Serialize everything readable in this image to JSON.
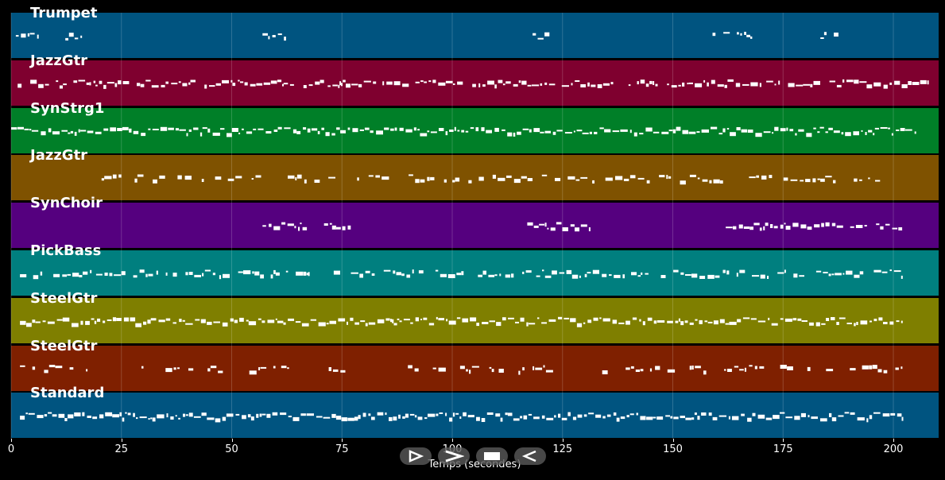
{
  "tracks": [
    {
      "name": "Trumpet",
      "color": "#005480",
      "segments": [
        [
          0,
          6
        ],
        [
          11,
          16
        ],
        [
          57,
          63
        ],
        [
          117,
          123
        ],
        [
          158,
          168
        ],
        [
          182,
          188
        ]
      ],
      "density": 0.5
    },
    {
      "name": "JazzGtr",
      "color": "#7f002f",
      "segments": [
        [
          0,
          208
        ]
      ],
      "density": 0.9
    },
    {
      "name": "SynStrg1",
      "color": "#007f28",
      "segments": [
        [
          0,
          205
        ]
      ],
      "density": 1.0
    },
    {
      "name": "JazzGtr",
      "color": "#7f5200",
      "segments": [
        [
          18,
          25
        ],
        [
          28,
          74
        ],
        [
          78,
          197
        ]
      ],
      "density": 0.6
    },
    {
      "name": "SynChoir",
      "color": "#55007f",
      "segments": [
        [
          57,
          77
        ],
        [
          117,
          131
        ],
        [
          162,
          202
        ]
      ],
      "density": 0.9
    },
    {
      "name": "PickBass",
      "color": "#007f7f",
      "segments": [
        [
          2,
          202
        ]
      ],
      "density": 0.75
    },
    {
      "name": "SteelGtr",
      "color": "#7f7f00",
      "segments": [
        [
          2,
          202
        ]
      ],
      "density": 1.0
    },
    {
      "name": "SteelGtr",
      "color": "#7f2000",
      "segments": [
        [
          2,
          17
        ],
        [
          25,
          30
        ],
        [
          35,
          48
        ],
        [
          54,
          63
        ],
        [
          72,
          76
        ],
        [
          84,
          112
        ],
        [
          115,
          123
        ],
        [
          132,
          202
        ]
      ],
      "density": 0.55
    },
    {
      "name": "Standard",
      "color": "#005480",
      "segments": [
        [
          2,
          202
        ]
      ],
      "density": 1.0
    }
  ],
  "axis": {
    "ticks": [
      "0",
      "25",
      "50",
      "75",
      "100",
      "125",
      "150",
      "175",
      "200"
    ],
    "xlabel": "Temps (secondes)",
    "xlim": [
      0,
      210
    ]
  },
  "controls": {
    "play_icon": "play-icon",
    "forward_icon": "forward-icon",
    "stop_icon": "stop-icon",
    "back_icon": "back-icon"
  }
}
